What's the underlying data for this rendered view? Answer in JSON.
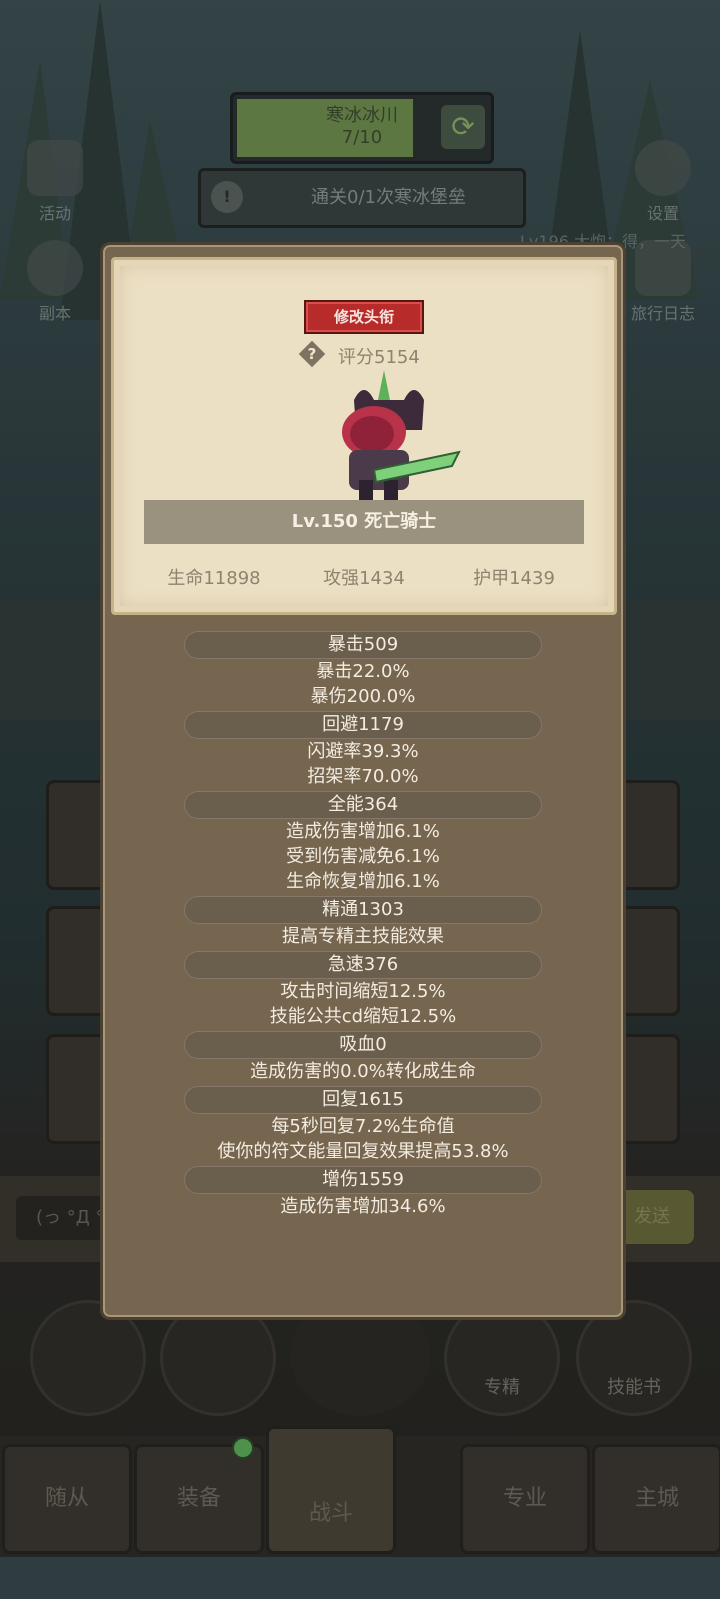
{
  "background": {
    "zone": {
      "name": "寒冰冰川",
      "progress": "7/10"
    },
    "quest": {
      "text": "通关0/1次寒冰堡垒"
    },
    "left_buttons": [
      "活动",
      "副本"
    ],
    "right_buttons": [
      "设置",
      "旅行日志"
    ],
    "chat_line": "Lv196 大炮：得，一天",
    "chat_input": "(っ °Д °",
    "send_label": "发送",
    "action_buttons": [
      "专精",
      "技能书"
    ],
    "tabs": [
      "随从",
      "装备",
      "战斗",
      "专业",
      "主城"
    ]
  },
  "popup": {
    "rename_label": "修改头衔",
    "score": "评分5154",
    "hero_name": "Lv.150 死亡骑士",
    "base_stats": [
      "生命11898",
      "攻强1434",
      "护甲1439"
    ],
    "attributes": [
      {
        "header": "暴击509",
        "lines": [
          "暴击22.0%",
          "暴伤200.0%"
        ]
      },
      {
        "header": "回避1179",
        "lines": [
          "闪避率39.3%",
          "招架率70.0%"
        ]
      },
      {
        "header": "全能364",
        "lines": [
          "造成伤害增加6.1%",
          "受到伤害减免6.1%",
          "生命恢复增加6.1%"
        ]
      },
      {
        "header": "精通1303",
        "lines": [
          "提高专精主技能效果"
        ]
      },
      {
        "header": "急速376",
        "lines": [
          "攻击时间缩短12.5%",
          "技能公共cd缩短12.5%"
        ]
      },
      {
        "header": "吸血0",
        "lines": [
          "造成伤害的0.0%转化成生命"
        ]
      },
      {
        "header": "回复1615",
        "lines": [
          "每5秒回复7.2%生命值",
          "使你的符文能量回复效果提高53.8%"
        ]
      },
      {
        "header": "增伤1559",
        "lines": [
          "造成伤害增加34.6%"
        ]
      }
    ]
  },
  "colors": {
    "rename_button": "#b82b2b",
    "zone_fill": "#6f8e4d",
    "notify_dot": "#5fae59"
  }
}
